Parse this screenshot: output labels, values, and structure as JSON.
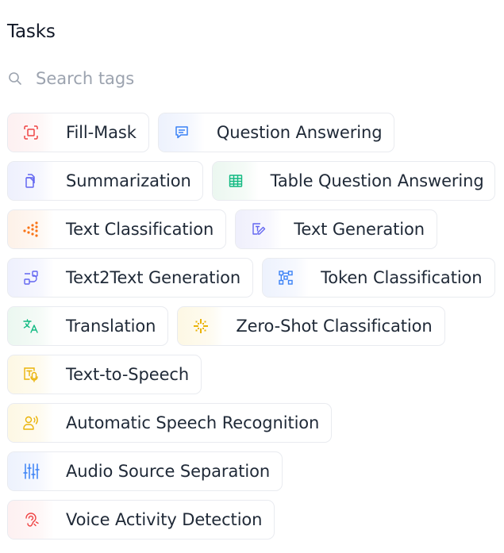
{
  "header": {
    "title": "Tasks"
  },
  "search": {
    "placeholder": "Search tags",
    "value": "",
    "icon": "search-icon"
  },
  "tags": [
    {
      "label": "Fill-Mask",
      "icon": "fill-mask-icon",
      "color": "#ef4444"
    },
    {
      "label": "Question Answering",
      "icon": "chat-bubble-icon",
      "color": "#3b82f6"
    },
    {
      "label": "Summarization",
      "icon": "documents-icon",
      "color": "#6366f1"
    },
    {
      "label": "Table Question Answering",
      "icon": "table-icon",
      "color": "#10b981"
    },
    {
      "label": "Text Classification",
      "icon": "dots-classification-icon",
      "color": "#f97316"
    },
    {
      "label": "Text Generation",
      "icon": "text-edit-icon",
      "color": "#6366f1"
    },
    {
      "label": "Text2Text Generation",
      "icon": "text-to-text-icon",
      "color": "#6366f1"
    },
    {
      "label": "Token Classification",
      "icon": "token-grid-icon",
      "color": "#3b82f6"
    },
    {
      "label": "Translation",
      "icon": "translate-icon",
      "color": "#10b981"
    },
    {
      "label": "Zero-Shot Classification",
      "icon": "sparkle-grid-icon",
      "color": "#eab308"
    },
    {
      "label": "Text-to-Speech",
      "icon": "text-speech-icon",
      "color": "#eab308"
    },
    {
      "label": "Automatic Speech Recognition",
      "icon": "speaker-person-icon",
      "color": "#eab308"
    },
    {
      "label": "Audio Source Separation",
      "icon": "sliders-icon",
      "color": "#3b82f6"
    },
    {
      "label": "Voice Activity Detection",
      "icon": "ear-icon",
      "color": "#ef4444"
    }
  ]
}
